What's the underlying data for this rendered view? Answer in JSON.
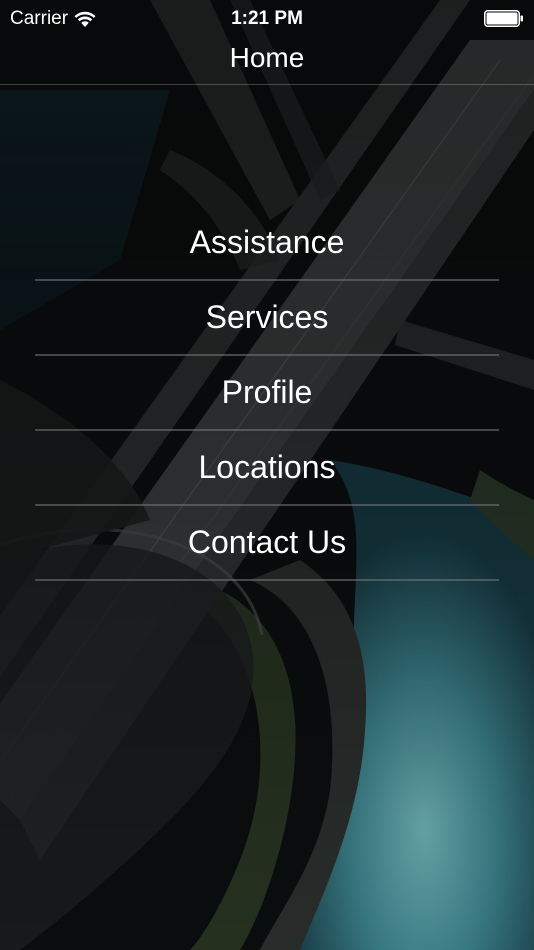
{
  "status_bar": {
    "carrier": "Carrier",
    "time": "1:21 PM",
    "wifi_icon": "wifi-icon",
    "battery_icon": "battery-full-icon"
  },
  "nav": {
    "title": "Home"
  },
  "menu": {
    "items": [
      {
        "label": "Assistance"
      },
      {
        "label": "Services"
      },
      {
        "label": "Profile"
      },
      {
        "label": "Locations"
      },
      {
        "label": "Contact Us"
      }
    ]
  },
  "colors": {
    "text": "#ffffff",
    "water": "#3f8a93",
    "background": "#0b0d0e",
    "divider": "#787878"
  }
}
